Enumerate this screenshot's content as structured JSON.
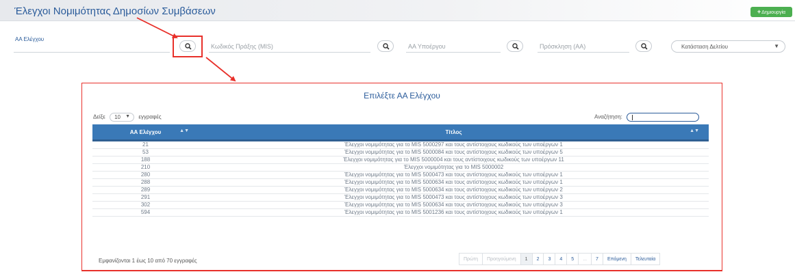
{
  "header": {
    "title": "Έλεγχοι Νομιμότητας Δημοσίων Συμβάσεων",
    "create_label": "Δημιουργία"
  },
  "filters": {
    "aa_label": "ΑΑ Ελέγχου",
    "mis_placeholder": "Κωδικός Πράξης (MIS)",
    "subproject_placeholder": "ΑΑ Υποέργου",
    "invitation_placeholder": "Πρόσκληση (ΑΑ)",
    "status_placeholder": "Κατάσταση Δελτίου"
  },
  "modal": {
    "title": "Επιλέξτε ΑΑ Ελέγχου",
    "show_label": "Δείξε",
    "page_size": "10",
    "records_label": "εγγραφές",
    "search_label": "Αναζήτηση:",
    "columns": [
      "ΑΑ Ελέγχου",
      "Τίτλος"
    ],
    "rows": [
      {
        "aa": "21",
        "title": "Έλεγχοι νομιμότητας για το MIS 5000297 και τους αντίστοιχους κωδικούς των υποέργων 1"
      },
      {
        "aa": "53",
        "title": "Έλεγχοι νομιμότητας για το MIS 5000084 και τους αντίστοιχους κωδικούς των υποέργων 5"
      },
      {
        "aa": "188",
        "title": "Έλεγχοι νομιμότητας για το MIS 5000004 και τους αντίστοιχους κωδικούς των υποέργων 11"
      },
      {
        "aa": "210",
        "title": "Έλεγχοι νομιμότητας για το MIS 5000002"
      },
      {
        "aa": "280",
        "title": "Έλεγχοι νομιμότητας για το MIS 5000473 και τους αντίστοιχους κωδικούς των υποέργων 1"
      },
      {
        "aa": "288",
        "title": "Έλεγχοι νομιμότητας για το MIS 5000634 και τους αντίστοιχους κωδικούς των υποέργων 1"
      },
      {
        "aa": "289",
        "title": "Έλεγχοι νομιμότητας για το MIS 5000634 και τους αντίστοιχους κωδικούς των υποέργων 2"
      },
      {
        "aa": "291",
        "title": "Έλεγχοι νομιμότητας για το MIS 5000473 και τους αντίστοιχους κωδικούς των υποέργων 3"
      },
      {
        "aa": "302",
        "title": "Έλεγχοι νομιμότητας για το MIS 5000634 και τους αντίστοιχους κωδικούς των υποέργων 3"
      },
      {
        "aa": "594",
        "title": "Έλεγχοι νομιμότητας για το MIS 5001236 και τους αντίστοιχους κωδικούς των υποέργων 1"
      }
    ],
    "info": "Εμφανίζονται 1 έως 10 από 70 εγγραφές",
    "pagination": {
      "first": "Πρώτη",
      "previous": "Προηγούμενη",
      "pages": [
        "1",
        "2",
        "3",
        "4",
        "5",
        "...",
        "7"
      ],
      "next": "Επόμενη",
      "last": "Τελευταία"
    }
  },
  "colors": {
    "accent": "#2a5b9a",
    "table_header": "#3a79b7",
    "create_button": "#4caf50",
    "highlight": "#e8302a"
  }
}
